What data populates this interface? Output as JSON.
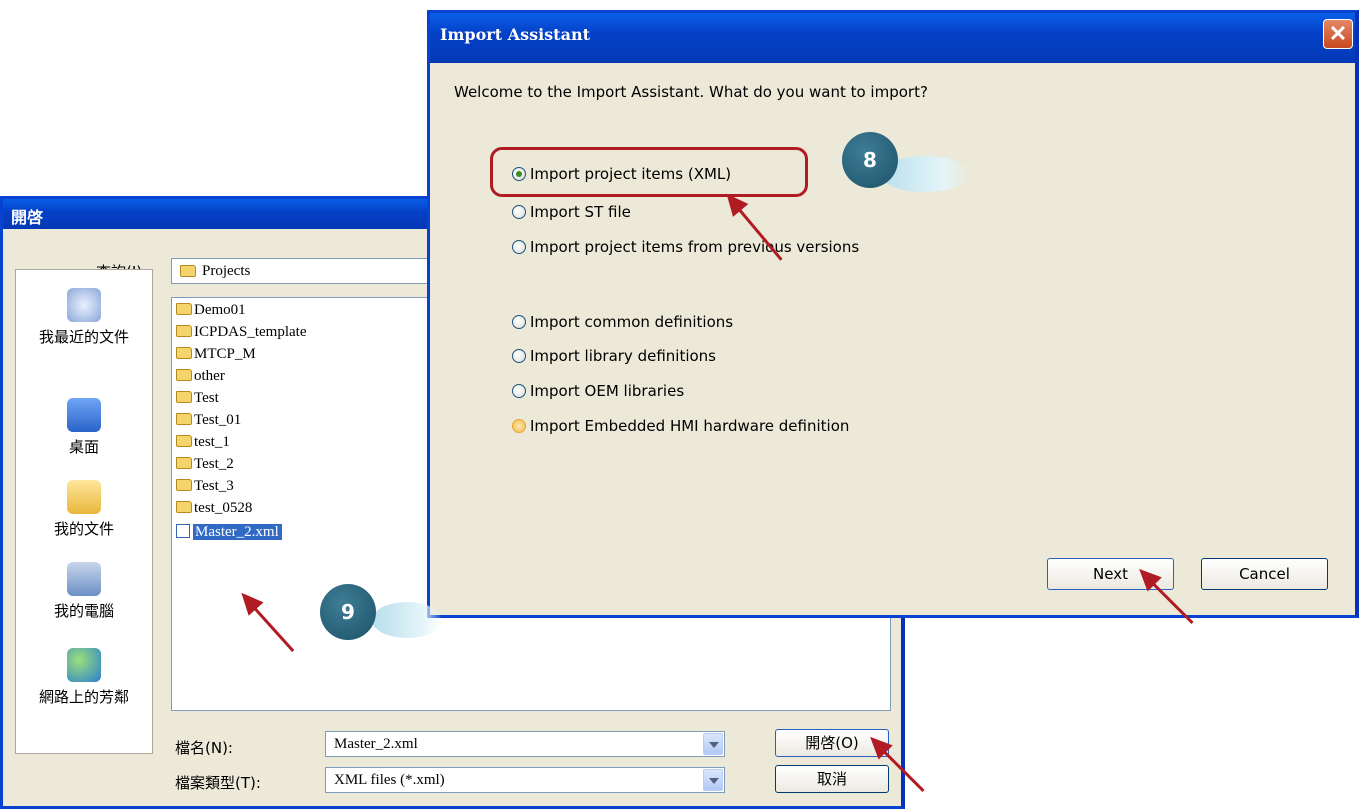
{
  "open_dialog": {
    "title": "開啓",
    "lookin_label": "查詢(I):",
    "lookin_value": "Projects",
    "places": [
      "我最近的文件",
      "桌面",
      "我的文件",
      "我的電腦",
      "網路上的芳鄰"
    ],
    "files": [
      {
        "name": "Demo01",
        "type": "folder"
      },
      {
        "name": "ICPDAS_template",
        "type": "folder"
      },
      {
        "name": "MTCP_M",
        "type": "folder"
      },
      {
        "name": "other",
        "type": "folder"
      },
      {
        "name": "Test",
        "type": "folder"
      },
      {
        "name": "Test_01",
        "type": "folder"
      },
      {
        "name": "test_1",
        "type": "folder"
      },
      {
        "name": "Test_2",
        "type": "folder"
      },
      {
        "name": "Test_3",
        "type": "folder"
      },
      {
        "name": "test_0528",
        "type": "folder"
      },
      {
        "name": "Master_2.xml",
        "type": "xml",
        "selected": true
      }
    ],
    "filename_label": "檔名(N):",
    "filename_value": "Master_2.xml",
    "filetype_label": "檔案類型(T):",
    "filetype_value": "XML files (*.xml)",
    "open_button": "開啓(O)",
    "cancel_button": "取消"
  },
  "import_dialog": {
    "title": "Import Assistant",
    "prompt": "Welcome to the Import Assistant. What do you want to import?",
    "options": [
      {
        "label": "Import project items (XML)",
        "checked": true
      },
      {
        "label": "Import ST file",
        "checked": false
      },
      {
        "label": "Import project items from previous versions",
        "checked": false
      },
      {
        "label": "Import common definitions",
        "checked": false
      },
      {
        "label": "Import library definitions",
        "checked": false
      },
      {
        "label": "Import OEM libraries",
        "checked": false
      },
      {
        "label": "Import Embedded HMI hardware definition",
        "checked": false,
        "hover": true
      }
    ],
    "next_button": "Next",
    "cancel_button": "Cancel"
  },
  "annotations": {
    "step8": "8",
    "step9": "9"
  },
  "colors": {
    "titlebar": "#0441c8",
    "dialog_bg": "#ece9d8",
    "highlight_box": "#b01b24",
    "badge": "#1c5268",
    "selection": "#316ac5"
  }
}
